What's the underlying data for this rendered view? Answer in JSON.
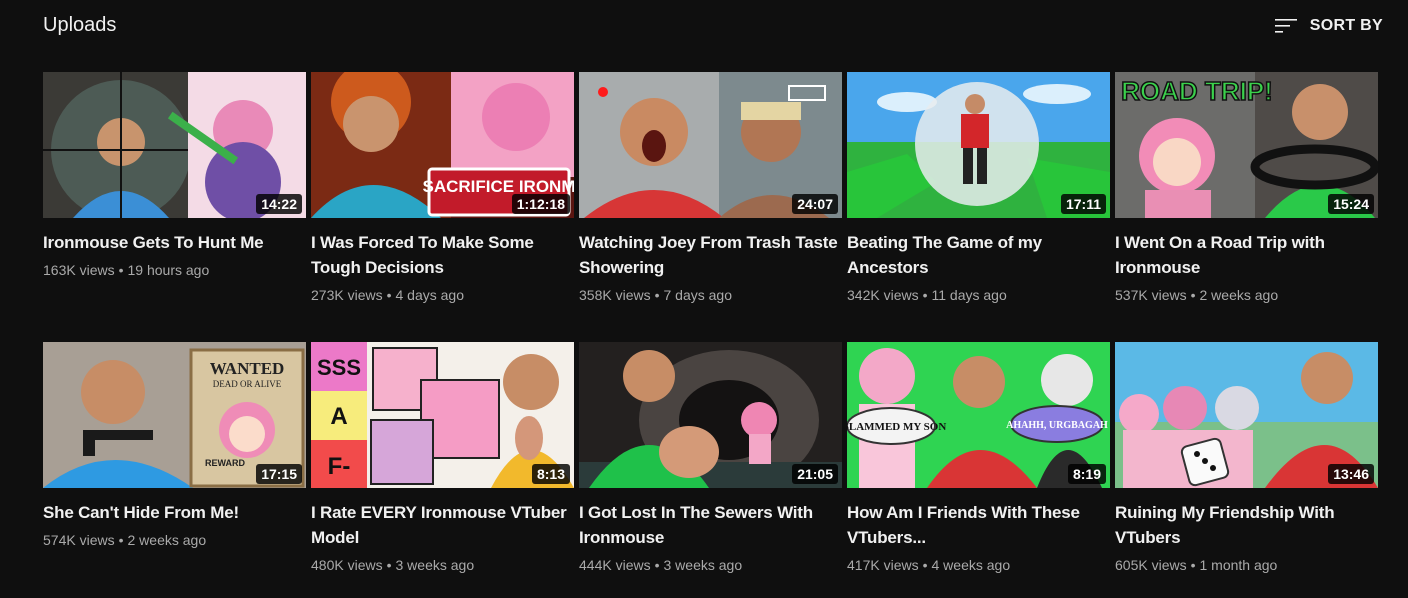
{
  "header": {
    "title": "Uploads",
    "sort_label": "SORT BY"
  },
  "videos": [
    {
      "title": "Ironmouse Gets To Hunt Me",
      "views": "163K views",
      "age": "19 hours ago",
      "duration": "14:22"
    },
    {
      "title": "I Was Forced To Make Some Tough Decisions",
      "views": "273K views",
      "age": "4 days ago",
      "duration": "1:12:18"
    },
    {
      "title": "Watching Joey From Trash Taste Showering",
      "views": "358K views",
      "age": "7 days ago",
      "duration": "24:07"
    },
    {
      "title": "Beating The Game of my Ancestors",
      "views": "342K views",
      "age": "11 days ago",
      "duration": "17:11"
    },
    {
      "title": "I Went On a Road Trip with Ironmouse",
      "views": "537K views",
      "age": "2 weeks ago",
      "duration": "15:24"
    },
    {
      "title": "She Can't Hide From Me!",
      "views": "574K views",
      "age": "2 weeks ago",
      "duration": "17:15"
    },
    {
      "title": "I Rate EVERY Ironmouse VTuber Model",
      "views": "480K views",
      "age": "3 weeks ago",
      "duration": "8:13"
    },
    {
      "title": "I Got Lost In The Sewers With Ironmouse",
      "views": "444K views",
      "age": "3 weeks ago",
      "duration": "21:05"
    },
    {
      "title": "How Am I Friends With These VTubers...",
      "views": "417K views",
      "age": "4 weeks ago",
      "duration": "8:19"
    },
    {
      "title": "Ruining My Friendship With VTubers",
      "views": "605K views",
      "age": "1 month ago",
      "duration": "13:46"
    }
  ],
  "thumbnail_text": {
    "t2": "SACRIFICE IRONM",
    "t5": "ROAD TRIP!",
    "t6a": "WANTED",
    "t6b": "DEAD OR ALIVE",
    "t6c": "REWARD",
    "t7a": "SSS",
    "t7b": "A",
    "t7c": "F-",
    "t9a": "I SLAMMED MY SON",
    "t9b": "AHAHH, URGBAGAH"
  },
  "colors": {
    "background": "#0f0f0f",
    "text_primary": "#f1f1f1",
    "text_secondary": "#aaaaaa"
  }
}
